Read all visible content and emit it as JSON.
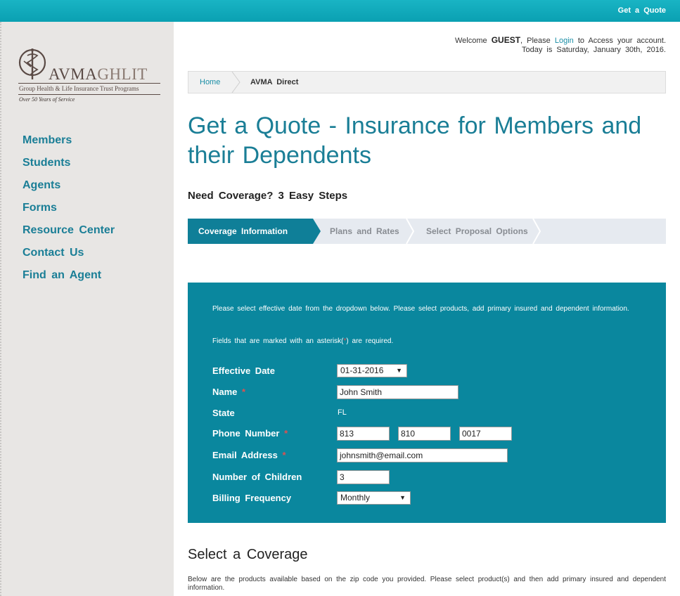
{
  "topbar": {
    "quote_link": "Get a Quote"
  },
  "logo": {
    "brand_main": "AVMA",
    "brand_accent": "GHLIT",
    "tagline": "Group Health & Life Insurance Trust Programs",
    "years": "Over 50 Years of Service"
  },
  "nav": {
    "items": [
      {
        "label": "Members"
      },
      {
        "label": "Students"
      },
      {
        "label": "Agents"
      },
      {
        "label": "Forms"
      },
      {
        "label": "Resource Center"
      },
      {
        "label": "Contact Us"
      },
      {
        "label": "Find an Agent"
      }
    ]
  },
  "welcome": {
    "prefix": "Welcome",
    "user": "GUEST",
    "mid": ", Please",
    "login": "Login",
    "suffix": "to Access your account.",
    "date_line": "Today is Saturday, January 30th, 2016."
  },
  "breadcrumb": {
    "home": "Home",
    "current": "AVMA Direct"
  },
  "page_title": "Get a Quote - Insurance for Members and their Dependents",
  "subhead": "Need Coverage? 3 Easy Steps",
  "steps": [
    {
      "label": "Coverage Information"
    },
    {
      "label": "Plans and Rates"
    },
    {
      "label": "Select Proposal Options"
    }
  ],
  "form": {
    "intro": "Please select effective date from the dropdown below. Please select products, add primary insured and dependent information.",
    "req_note_pre": "Fields that are marked with an asterisk(",
    "req_note_ast": "*",
    "req_note_post": ") are required.",
    "effective_date": {
      "label": "Effective Date",
      "value": "01-31-2016"
    },
    "name": {
      "label": "Name",
      "value": "John Smith"
    },
    "state": {
      "label": "State",
      "value": "FL"
    },
    "phone": {
      "label": "Phone Number",
      "area": "813",
      "prefix": "810",
      "line": "0017"
    },
    "email": {
      "label": "Email Address",
      "value": "johnsmith@email.com"
    },
    "children": {
      "label": "Number of Children",
      "value": "3"
    },
    "billing": {
      "label": "Billing Frequency",
      "value": "Monthly"
    },
    "asterisk": "*"
  },
  "coverage": {
    "title": "Select a Coverage",
    "text": "Below are the products available based on the zip code you provided. Please select product(s) and then add primary insured and dependent information."
  },
  "colors": {
    "teal_dark": "#0a879e",
    "link": "#1a7e96",
    "topbar": "#19b4c4",
    "sidebar": "#e8e6e4"
  }
}
